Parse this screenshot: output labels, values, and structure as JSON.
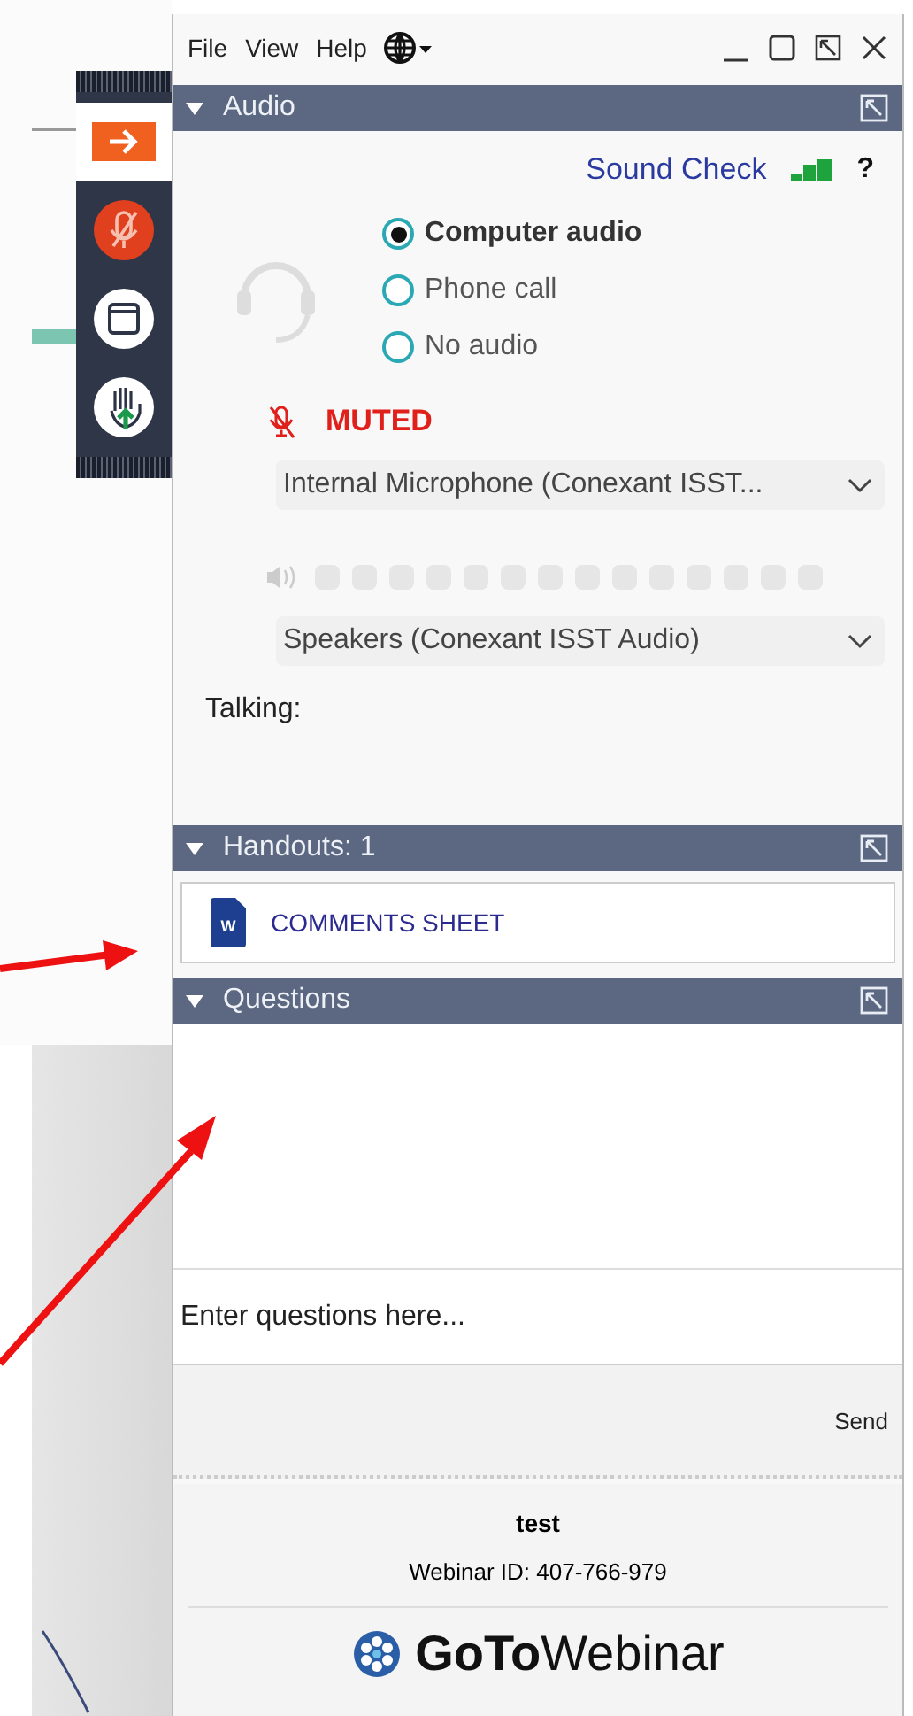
{
  "menu": [
    "File",
    "View",
    "Help"
  ],
  "audio": {
    "title": "Audio",
    "expanded": true,
    "sound_check": "Sound Check",
    "help": "?",
    "options": [
      {
        "label": "Computer audio",
        "selected": true
      },
      {
        "label": "Phone call",
        "selected": false
      },
      {
        "label": "No audio",
        "selected": false
      }
    ],
    "mic_status": "MUTED",
    "microphone": "Internal Microphone (Conexant ISST...",
    "speakers": "Speakers (Conexant ISST Audio)",
    "talking": "Talking:"
  },
  "handouts": {
    "title": "Handouts: 1",
    "expanded": true,
    "files": [
      {
        "icon_label": "W",
        "name": "COMMENTS SHEET"
      }
    ]
  },
  "questions": {
    "title": "Questions",
    "expanded": true,
    "placeholder": "Enter questions here...",
    "send": "Send"
  },
  "footer": {
    "title": "test",
    "webinar_id": "Webinar ID: 407-766-979",
    "logo": "**GoTo**Webinar"
  }
}
